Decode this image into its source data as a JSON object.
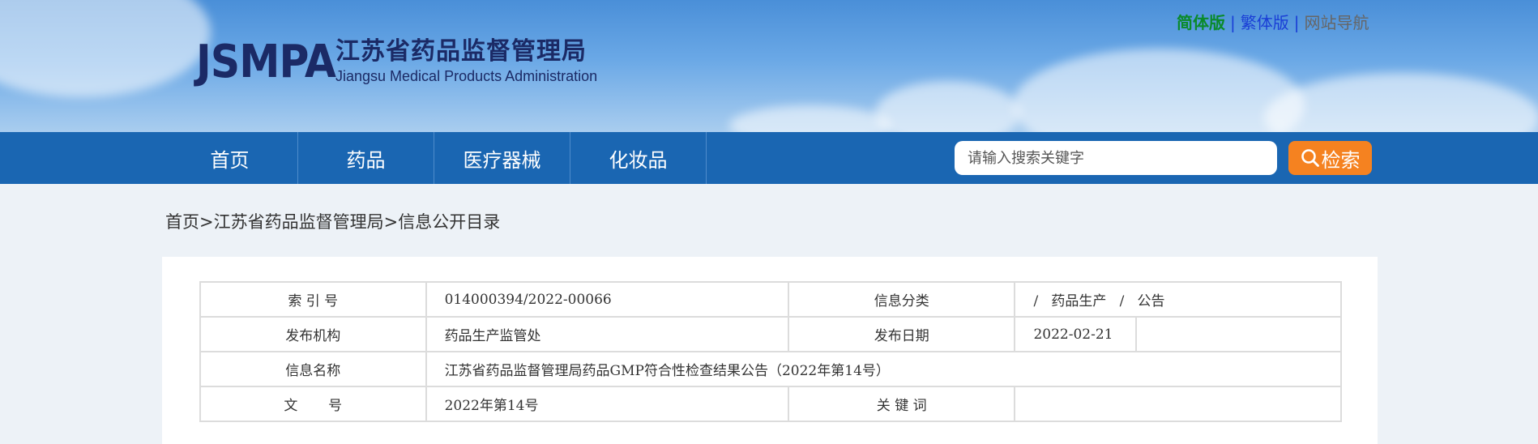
{
  "header": {
    "logo_mark": "JSMPA",
    "logo_cn": "江苏省药品监督管理局",
    "logo_en": "Jiangsu Medical Products Administration",
    "links": [
      "简体版",
      "繁体版",
      "网站导航"
    ],
    "link_sep": "|"
  },
  "nav": {
    "items": [
      "首页",
      "药品",
      "医疗器械",
      "化妆品"
    ],
    "search_placeholder": "请输入搜索关键字",
    "search_label": "检索"
  },
  "breadcrumb": {
    "items": [
      "首页",
      "江苏省药品监督管理局",
      "信息公开目录"
    ],
    "sep": ">"
  },
  "meta": {
    "index_label": "索 引 号",
    "index_value": "014000394/2022-00066",
    "category_label": "信息分类",
    "category_value": "/   药品生产   /   公告",
    "org_label": "发布机构",
    "org_value": "药品生产监管处",
    "date_label": "发布日期",
    "date_value": "2022-02-21",
    "name_label": "信息名称",
    "name_value": "江苏省药品监督管理局药品GMP符合性检查结果公告（2022年第14号）",
    "doc_label": "文       号",
    "doc_value": "2022年第14号",
    "keyword_label": "关 键 词",
    "keyword_value": ""
  }
}
